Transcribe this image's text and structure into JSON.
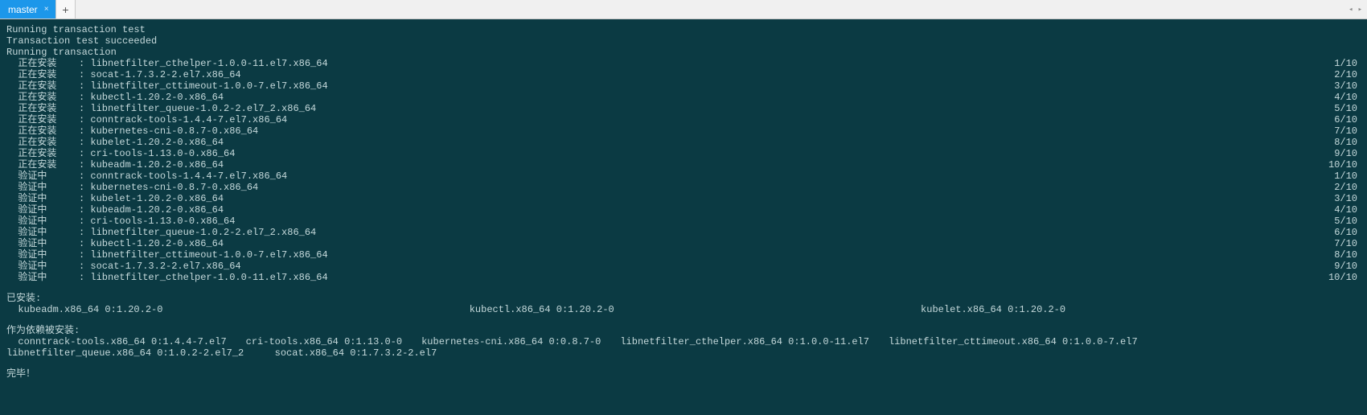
{
  "tabs": {
    "active": "master",
    "close_glyph": "×",
    "add_glyph": "+",
    "left_arrow": "◂",
    "right_arrow": "▸"
  },
  "term": {
    "pre_lines": [
      "Running transaction test",
      "Transaction test succeeded",
      "Running transaction"
    ],
    "rows": [
      {
        "action": "正在安装",
        "sep": ": ",
        "pkg": "libnetfilter_cthelper-1.0.0-11.el7.x86_64",
        "right": "1/10"
      },
      {
        "action": "正在安装",
        "sep": ": ",
        "pkg": "socat-1.7.3.2-2.el7.x86_64",
        "right": "2/10"
      },
      {
        "action": "正在安装",
        "sep": ": ",
        "pkg": "libnetfilter_cttimeout-1.0.0-7.el7.x86_64",
        "right": "3/10"
      },
      {
        "action": "正在安装",
        "sep": ": ",
        "pkg": "kubectl-1.20.2-0.x86_64",
        "right": "4/10"
      },
      {
        "action": "正在安装",
        "sep": ": ",
        "pkg": "libnetfilter_queue-1.0.2-2.el7_2.x86_64",
        "right": "5/10"
      },
      {
        "action": "正在安装",
        "sep": ": ",
        "pkg": "conntrack-tools-1.4.4-7.el7.x86_64",
        "right": "6/10"
      },
      {
        "action": "正在安装",
        "sep": ": ",
        "pkg": "kubernetes-cni-0.8.7-0.x86_64",
        "right": "7/10"
      },
      {
        "action": "正在安装",
        "sep": ": ",
        "pkg": "kubelet-1.20.2-0.x86_64",
        "right": "8/10"
      },
      {
        "action": "正在安装",
        "sep": ": ",
        "pkg": "cri-tools-1.13.0-0.x86_64",
        "right": "9/10"
      },
      {
        "action": "正在安装",
        "sep": ": ",
        "pkg": "kubeadm-1.20.2-0.x86_64",
        "right": "10/10"
      },
      {
        "action": "验证中",
        "sep": ": ",
        "pkg": "conntrack-tools-1.4.4-7.el7.x86_64",
        "right": "1/10"
      },
      {
        "action": "验证中",
        "sep": ": ",
        "pkg": "kubernetes-cni-0.8.7-0.x86_64",
        "right": "2/10"
      },
      {
        "action": "验证中",
        "sep": ": ",
        "pkg": "kubelet-1.20.2-0.x86_64",
        "right": "3/10"
      },
      {
        "action": "验证中",
        "sep": ": ",
        "pkg": "kubeadm-1.20.2-0.x86_64",
        "right": "4/10"
      },
      {
        "action": "验证中",
        "sep": ": ",
        "pkg": "cri-tools-1.13.0-0.x86_64",
        "right": "5/10"
      },
      {
        "action": "验证中",
        "sep": ": ",
        "pkg": "libnetfilter_queue-1.0.2-2.el7_2.x86_64",
        "right": "6/10"
      },
      {
        "action": "验证中",
        "sep": ": ",
        "pkg": "kubectl-1.20.2-0.x86_64",
        "right": "7/10"
      },
      {
        "action": "验证中",
        "sep": ": ",
        "pkg": "libnetfilter_cttimeout-1.0.0-7.el7.x86_64",
        "right": "8/10"
      },
      {
        "action": "验证中",
        "sep": ": ",
        "pkg": "socat-1.7.3.2-2.el7.x86_64",
        "right": "9/10"
      },
      {
        "action": "验证中",
        "sep": ": ",
        "pkg": "libnetfilter_cthelper-1.0.0-11.el7.x86_64",
        "right": "10/10"
      }
    ],
    "installed_header": "已安装:",
    "installed": [
      "  kubeadm.x86_64 0:1.20.2-0",
      "  kubectl.x86_64 0:1.20.2-0",
      "  kubelet.x86_64 0:1.20.2-0"
    ],
    "deps_header": "作为依赖被安装:",
    "deps": [
      "  conntrack-tools.x86_64 0:1.4.4-7.el7",
      "cri-tools.x86_64 0:1.13.0-0",
      "kubernetes-cni.x86_64 0:0.8.7-0",
      "libnetfilter_cthelper.x86_64 0:1.0.0-11.el7",
      "libnetfilter_cttimeout.x86_64 0:1.0.0-7.el7",
      "libnetfilter_queue.x86_64 0:1.0.2-2.el7_2",
      "  socat.x86_64 0:1.7.3.2-2.el7"
    ],
    "done": "完毕！"
  }
}
